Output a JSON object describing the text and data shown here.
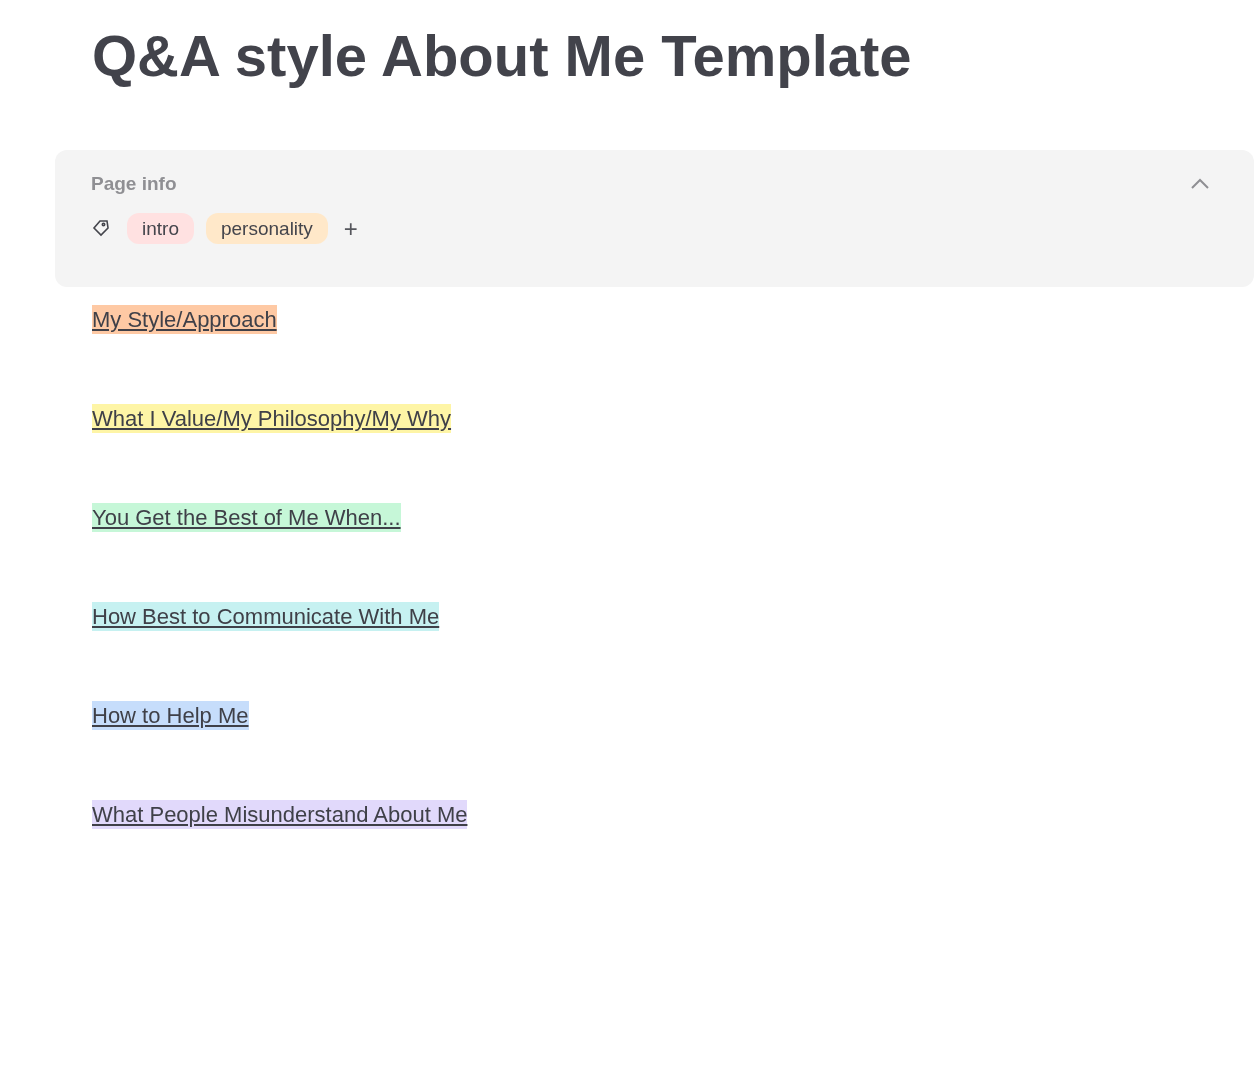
{
  "title": "Q&A style About Me Template",
  "page_info": {
    "heading": "Page info",
    "expanded": true,
    "tags": [
      {
        "label": "intro",
        "color": "#ffe1e1"
      },
      {
        "label": "personality",
        "color": "#ffe8c9"
      }
    ],
    "add_label": "+"
  },
  "links": [
    {
      "label": "My Style/Approach",
      "color": "#fec9a4"
    },
    {
      "label": "What I Value/My Philosophy/My Why",
      "color": "#fef5a6"
    },
    {
      "label": "You Get the Best of Me When...",
      "color": "#c6f7d8"
    },
    {
      "label": "How Best to Communicate With Me",
      "color": "#c6f1f1"
    },
    {
      "label": "How to Help Me",
      "color": "#c6ddfb"
    },
    {
      "label": "What People Misunderstand About Me",
      "color": "#e1d9fb"
    }
  ]
}
